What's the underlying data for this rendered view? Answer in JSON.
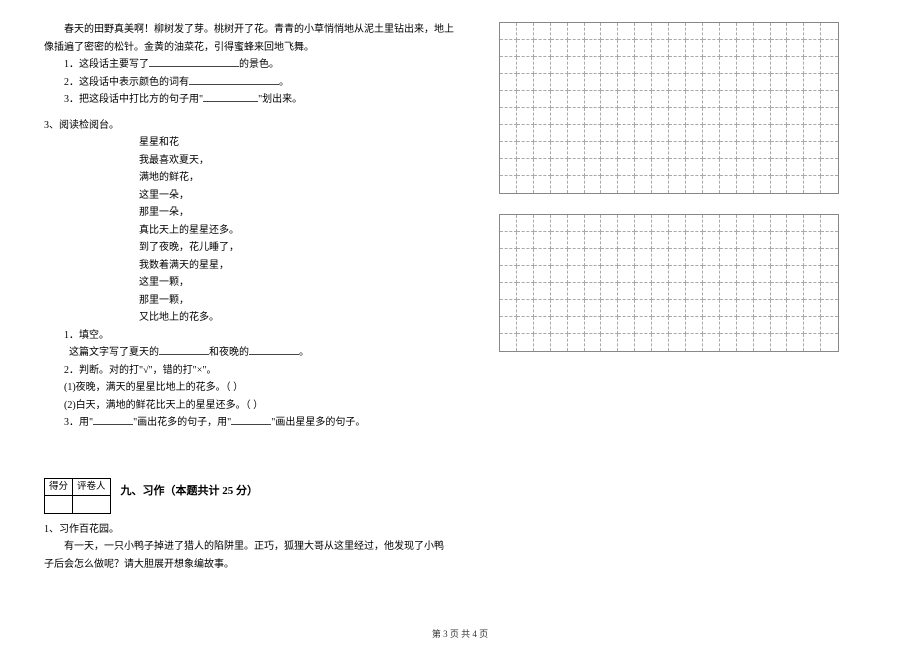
{
  "passage1": {
    "text_line1": "春天的田野真美啊！柳树发了芽。桃树开了花。青青的小草悄悄地从泥土里钻出来，地上",
    "text_line2": "像插遍了密密的松针。金黄的油菜花，引得蜜蜂来回地飞舞。",
    "q1_prefix": "1．这段话主要写了",
    "q1_suffix": "的景色。",
    "q2_prefix": "2．这段话中表示颜色的词有",
    "q2_suffix": "。",
    "q3_prefix": "3．把这段话中打比方的句子用\"",
    "q3_suffix": "\"划出来。"
  },
  "passage2": {
    "heading": "3、阅读检阅台。",
    "poem_title": "星星和花",
    "poem": [
      "我最喜欢夏天，",
      "满地的鲜花，",
      "这里一朵，",
      "那里一朵，",
      "真比天上的星星还多。",
      "到了夜晚，花儿睡了，",
      "我数着满天的星星，",
      "这里一颗，",
      "那里一颗，",
      "又比地上的花多。"
    ],
    "q1_label": "1．填空。",
    "q1_text_a": "这篇文字写了夏天的",
    "q1_text_b": "和夜晚的",
    "q1_text_c": "。",
    "q2_label": "2．判断。对的打\"√\"，错的打\"×\"。",
    "q2_item1": "(1)夜晚，满天的星星比地上的花多。（     ）",
    "q2_item2": "(2)白天，满地的鲜花比天上的星星还多。（     ）",
    "q3_prefix": "3．用\"",
    "q3_mid": "\"画出花多的句子，用\"",
    "q3_suffix": "\"画出星星多的句子。"
  },
  "score": {
    "col1": "得分",
    "col2": "评卷人"
  },
  "section9": {
    "title": "九、习作（本题共计 25 分）",
    "q_label": "1、习作百花园。",
    "q_line1": "有一天，一只小鸭子掉进了猎人的陷阱里。正巧，狐狸大哥从这里经过，他发现了小鸭",
    "q_line2": "子后会怎么做呢？请大胆展开想象编故事。"
  },
  "footer": "第 3 页 共 4 页",
  "grid": {
    "rows1": 10,
    "rows2": 8,
    "cols": 20
  }
}
